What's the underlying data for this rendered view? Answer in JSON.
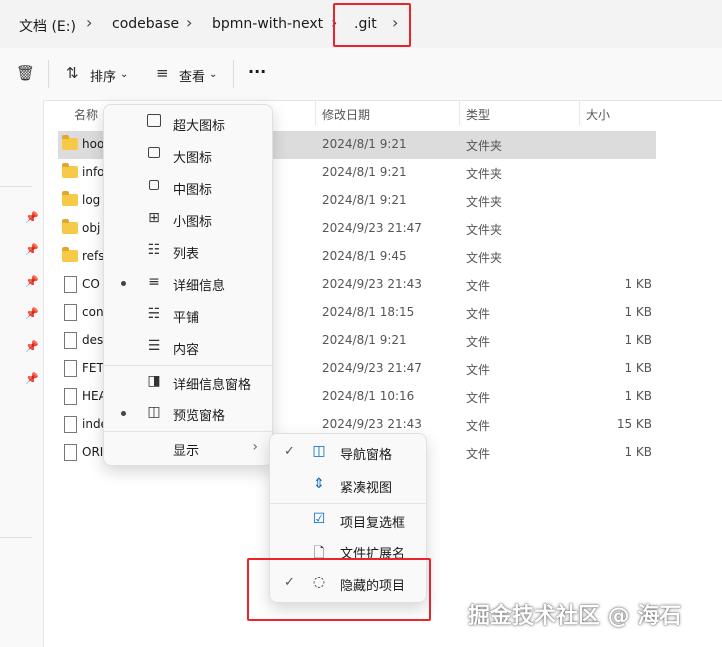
{
  "breadcrumb": [
    "文档 (E:)",
    "codebase",
    "bpmn-with-next",
    ".git"
  ],
  "toolbar": {
    "sort": "排序",
    "view": "查看",
    "more": "···"
  },
  "columns": {
    "name": "名称",
    "date": "修改日期",
    "type": "类型",
    "size": "大小"
  },
  "files": [
    {
      "name": "hoo",
      "date": "2024/8/1 9:21",
      "type": "文件夹",
      "size": "",
      "kind": "folder",
      "selected": true
    },
    {
      "name": "info",
      "date": "2024/8/1 9:21",
      "type": "文件夹",
      "size": "",
      "kind": "folder"
    },
    {
      "name": "log",
      "date": "2024/8/1 9:21",
      "type": "文件夹",
      "size": "",
      "kind": "folder"
    },
    {
      "name": "obj",
      "date": "2024/9/23 21:47",
      "type": "文件夹",
      "size": "",
      "kind": "folder"
    },
    {
      "name": "refs",
      "date": "2024/8/1 9:45",
      "type": "文件夹",
      "size": "",
      "kind": "folder"
    },
    {
      "name": "CO",
      "date": "2024/9/23 21:43",
      "type": "文件",
      "size": "1 KB",
      "kind": "file"
    },
    {
      "name": "con",
      "date": "2024/8/1 18:15",
      "type": "文件",
      "size": "1 KB",
      "kind": "file"
    },
    {
      "name": "des",
      "date": "2024/8/1 9:21",
      "type": "文件",
      "size": "1 KB",
      "kind": "file"
    },
    {
      "name": "FET",
      "date": "2024/9/23 21:47",
      "type": "文件",
      "size": "1 KB",
      "kind": "file"
    },
    {
      "name": "HEA",
      "date": "2024/8/1 10:16",
      "type": "文件",
      "size": "1 KB",
      "kind": "file"
    },
    {
      "name": "inde",
      "date": "2024/9/23 21:43",
      "type": "文件",
      "size": "15 KB",
      "kind": "file"
    },
    {
      "name": "ORI",
      "date": "",
      "type": "文件",
      "size": "1 KB",
      "kind": "file"
    }
  ],
  "view_menu": [
    {
      "label": "超大图标",
      "icon": "extra-large-icons-icon"
    },
    {
      "label": "大图标",
      "icon": "large-icons-icon"
    },
    {
      "label": "中图标",
      "icon": "medium-icons-icon"
    },
    {
      "label": "小图标",
      "icon": "small-icons-icon"
    },
    {
      "label": "列表",
      "icon": "list-icon"
    },
    {
      "label": "详细信息",
      "icon": "details-icon",
      "selected": true
    },
    {
      "label": "平铺",
      "icon": "tiles-icon"
    },
    {
      "label": "内容",
      "icon": "content-icon"
    },
    {
      "label": "详细信息窗格",
      "icon": "details-pane-icon"
    },
    {
      "label": "预览窗格",
      "icon": "preview-pane-icon",
      "selected": true
    },
    {
      "label": "显示",
      "icon": "",
      "submenu": true
    }
  ],
  "show_submenu": [
    {
      "label": "导航窗格",
      "checked": true,
      "icon": "navigation-pane-icon"
    },
    {
      "label": "紧凑视图",
      "checked": false,
      "icon": "compact-view-icon"
    },
    {
      "label": "项目复选框",
      "checked": false,
      "icon": "item-checkboxes-icon"
    },
    {
      "label": "文件扩展名",
      "checked": false,
      "icon": "file-extensions-icon"
    },
    {
      "label": "隐藏的项目",
      "checked": true,
      "icon": "hidden-items-icon"
    }
  ],
  "watermark": "掘金技术社区 @ 海石",
  "colors": {
    "highlight": "#e8262a",
    "selected_row": "#dcdcdc",
    "accent": "#0067c0"
  }
}
